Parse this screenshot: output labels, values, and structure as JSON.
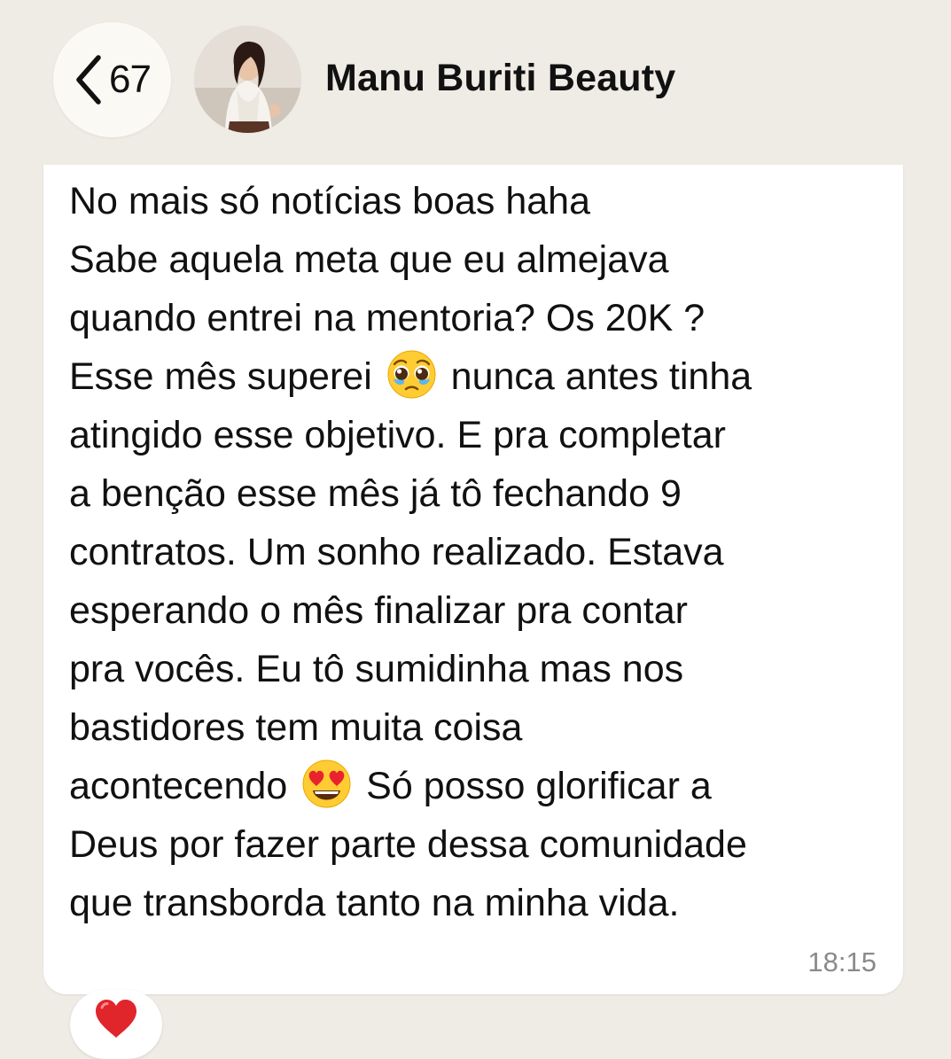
{
  "header": {
    "back_count": "67",
    "contact_name": "Manu Buriti Beauty",
    "back_icon": "chevron-left-icon",
    "avatar": "contact-avatar-photo"
  },
  "message": {
    "lines": [
      "No mais só notícias boas haha",
      "Sabe aquela meta que eu almejava",
      "quando entrei na mentoria? Os 20K ?",
      "Esse mês superei",
      "nunca antes tinha",
      "atingido esse objetivo. E pra completar",
      "a benção esse mês já tô fechando 9",
      "contratos. Um sonho realizado. Estava",
      "esperando o mês finalizar pra contar",
      "pra vocês. Eu tô sumidinha mas nos",
      "bastidores tem muita coisa",
      "acontecendo",
      "Só posso glorificar a",
      "Deus por fazer parte dessa comunidade",
      "que transborda tanto na minha vida."
    ],
    "emojis": [
      "pleading-face-emoji",
      "heart-eyes-emoji"
    ],
    "timestamp": "18:15"
  },
  "reaction": {
    "icon": "red-heart-icon"
  },
  "colors": {
    "background": "#efebe5",
    "bubble": "#ffffff",
    "timestamp": "#8a8a8a",
    "heart": "#e0262b"
  }
}
